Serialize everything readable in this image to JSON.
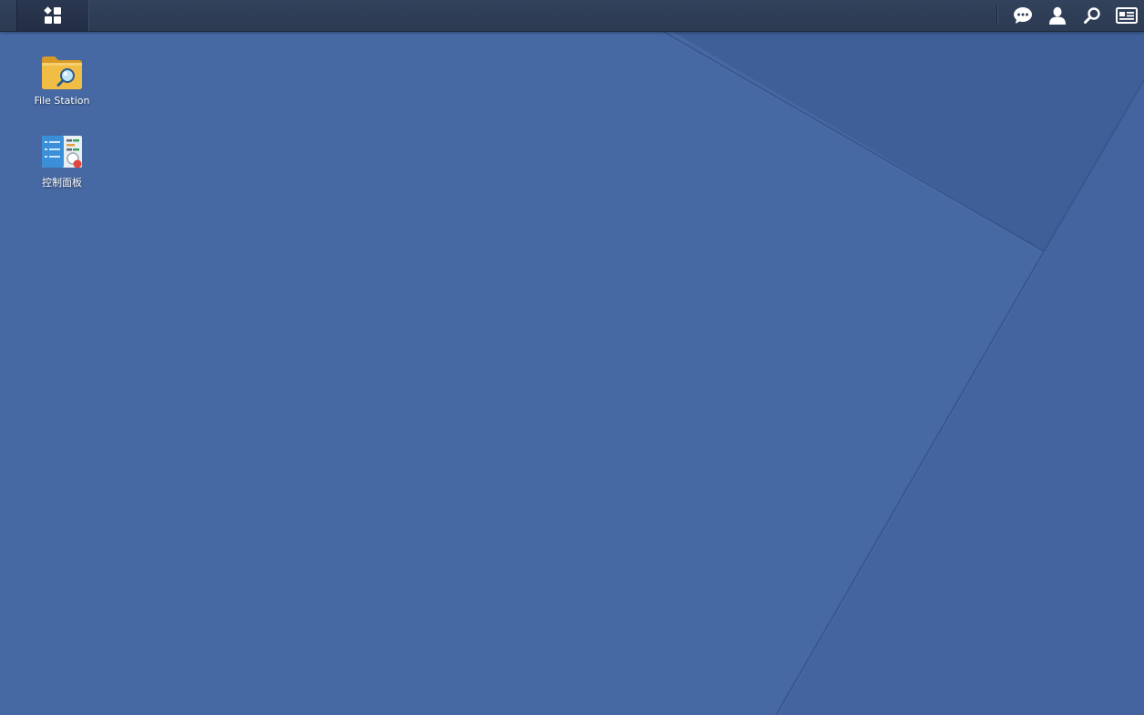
{
  "taskbar": {
    "main_menu_icon": "main-menu-grid-icon",
    "tray": [
      {
        "id": "notifications",
        "icon": "chat-bubble-icon"
      },
      {
        "id": "user",
        "icon": "user-icon"
      },
      {
        "id": "search",
        "icon": "search-icon"
      },
      {
        "id": "widgets",
        "icon": "widgets-panel-icon"
      }
    ]
  },
  "desktop": {
    "shortcuts": [
      {
        "label": "File Station",
        "icon": "folder-search-icon"
      },
      {
        "label": "控制面板",
        "icon": "control-panel-icon"
      }
    ]
  },
  "colors": {
    "wallpaper": "#4669a4",
    "taskbar": "#2f3e57",
    "folder": "#f0b93e",
    "badge": "#e2453c"
  }
}
